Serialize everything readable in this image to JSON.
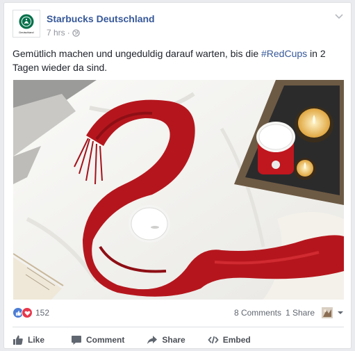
{
  "page": {
    "name": "Starbucks Deutschland",
    "logo_caption": "Deutschland",
    "time": "7 hrs",
    "separator": "·"
  },
  "post": {
    "text_before": "Gemütlich machen und ungeduldig darauf warten, bis die ",
    "hashtag": "#RedCups",
    "text_after": " in 2 Tagen wieder da sind."
  },
  "stats": {
    "reaction_count": "152",
    "comments": "8 Comments",
    "shares": "1 Share"
  },
  "actions": {
    "like": "Like",
    "comment": "Comment",
    "share": "Share",
    "embed": "Embed"
  },
  "colors": {
    "link": "#365899",
    "like_blue": "#4c7dd4",
    "love_red": "#e8374b",
    "scarf_red": "#b5161d",
    "starbucks_green": "#00704a"
  },
  "icons": [
    "starbucks-logo-icon",
    "globe-icon",
    "chevron-down-icon",
    "like-reaction-icon",
    "love-reaction-icon",
    "thumbs-up-icon",
    "comment-icon",
    "share-icon",
    "embed-icon",
    "caret-down-icon"
  ]
}
